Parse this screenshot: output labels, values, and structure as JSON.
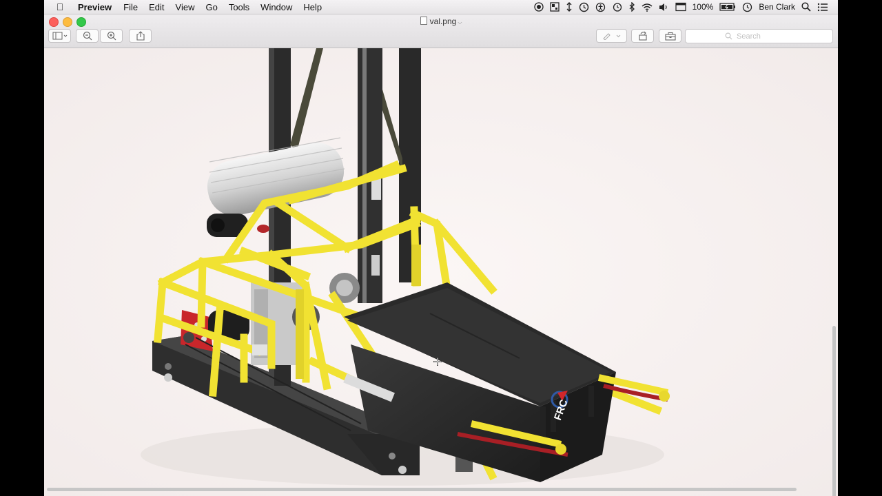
{
  "menubar": {
    "app_name": "Preview",
    "menus": [
      "File",
      "Edit",
      "View",
      "Go",
      "Tools",
      "Window",
      "Help"
    ],
    "battery": "100%",
    "user": "Ben Clark"
  },
  "window": {
    "title": "val.png",
    "search_placeholder": "Search"
  },
  "image": {
    "subject": "FRC robot CAD render",
    "logo_text": "FRC",
    "colors": {
      "frame": "#f2e33a",
      "tower": "#2d2d2d",
      "tote": "#262626",
      "belt": "#a81f25"
    }
  }
}
